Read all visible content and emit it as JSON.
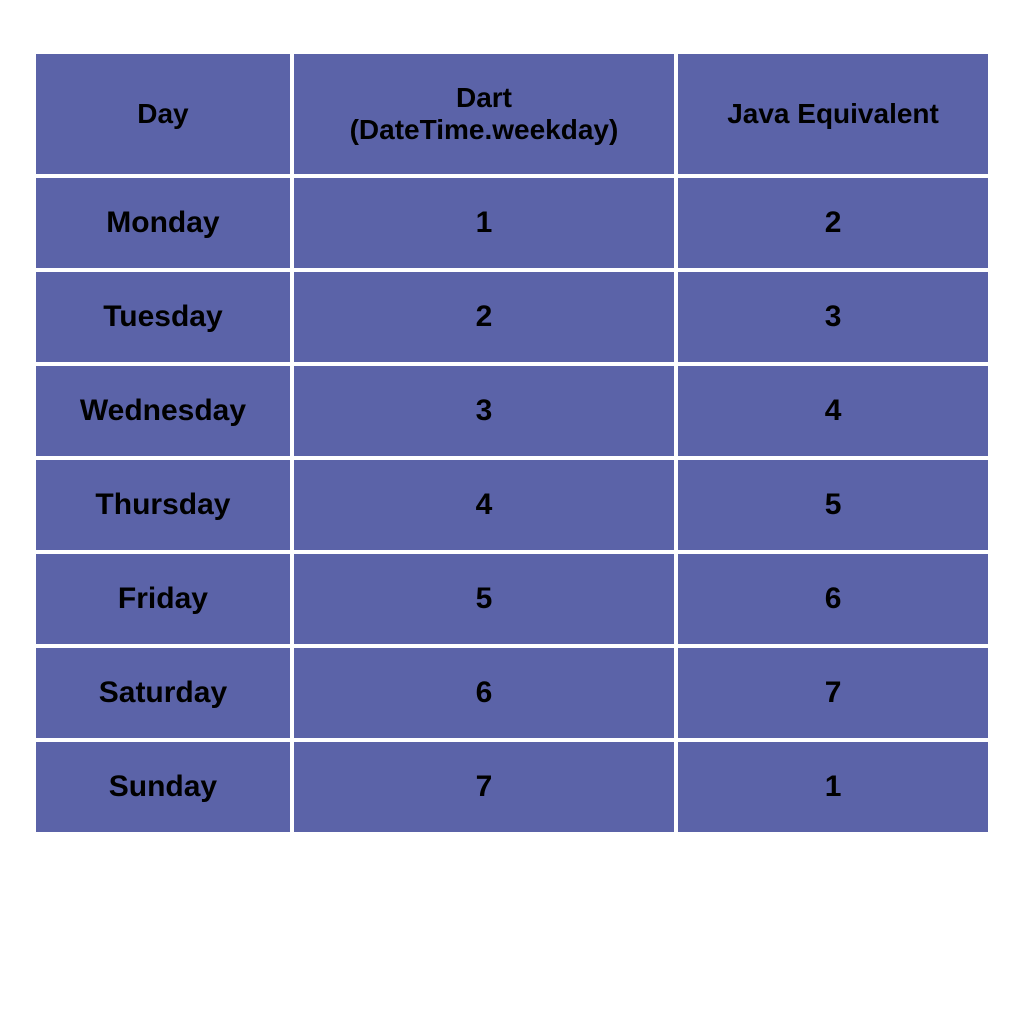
{
  "table": {
    "columns": [
      {
        "label": "Day"
      },
      {
        "label": "Dart\n(DateTime.weekday)"
      },
      {
        "label": "Java Equivalent"
      }
    ],
    "rows": [
      {
        "day": "Monday",
        "dart": "1",
        "java": "2"
      },
      {
        "day": "Tuesday",
        "dart": "2",
        "java": "3"
      },
      {
        "day": "Wednesday",
        "dart": "3",
        "java": "4"
      },
      {
        "day": "Thursday",
        "dart": "4",
        "java": "5"
      },
      {
        "day": "Friday",
        "dart": "5",
        "java": "6"
      },
      {
        "day": "Saturday",
        "dart": "6",
        "java": "7"
      },
      {
        "day": "Sunday",
        "dart": "7",
        "java": "1"
      }
    ]
  }
}
